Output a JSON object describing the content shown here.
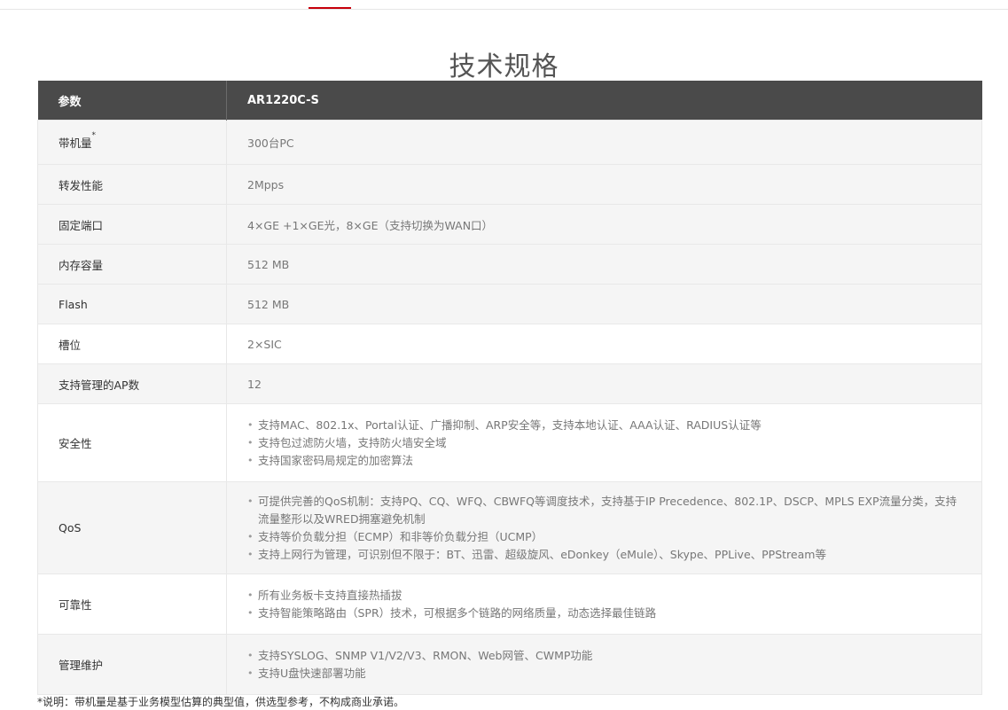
{
  "page": {
    "title": "技术规格",
    "footnote": "*说明：带机量是基于业务模型估算的典型值，供选型参考，不构成商业承诺。"
  },
  "colors": {
    "accent": "#c7000b",
    "header_bg": "#4a4a4a",
    "row_alt_bg": "#f5f5f5"
  },
  "table": {
    "headers": [
      "参数",
      "AR1220C-S"
    ],
    "rows": [
      {
        "label": "带机量",
        "sup": "*",
        "value": "300台PC"
      },
      {
        "label": "转发性能",
        "value": "2Mpps"
      },
      {
        "label": "固定端口",
        "value": "4×GE +1×GE光，8×GE（支持切换为WAN口）"
      },
      {
        "label": "内存容量",
        "value": "512 MB"
      },
      {
        "label": "Flash",
        "value": "512 MB"
      },
      {
        "label": "槽位",
        "value": "2×SIC"
      },
      {
        "label": "支持管理的AP数",
        "value": "12"
      },
      {
        "label": "安全性",
        "items": [
          "支持MAC、802.1x、Portal认证、广播抑制、ARP安全等，支持本地认证、AAA认证、RADIUS认证等",
          "支持包过滤防火墙，支持防火墙安全域",
          "支持国家密码局规定的加密算法"
        ]
      },
      {
        "label": "QoS",
        "items": [
          "可提供完善的QoS机制：支持PQ、CQ、WFQ、CBWFQ等调度技术，支持基于IP Precedence、802.1P、DSCP、MPLS EXP流量分类，支持流量整形以及WRED拥塞避免机制",
          "支持等价负载分担（ECMP）和非等价负载分担（UCMP）",
          "支持上网行为管理，可识别但不限于：BT、迅雷、超级旋风、eDonkey（eMule）、Skype、PPLive、PPStream等"
        ]
      },
      {
        "label": "可靠性",
        "items": [
          "所有业务板卡支持直接热插拔",
          "支持智能策略路由（SPR）技术，可根据多个链路的网络质量，动态选择最佳链路"
        ]
      },
      {
        "label": "管理维护",
        "items": [
          "支持SYSLOG、SNMP V1/V2/V3、RMON、Web网管、CWMP功能",
          "支持U盘快速部署功能"
        ]
      }
    ]
  }
}
